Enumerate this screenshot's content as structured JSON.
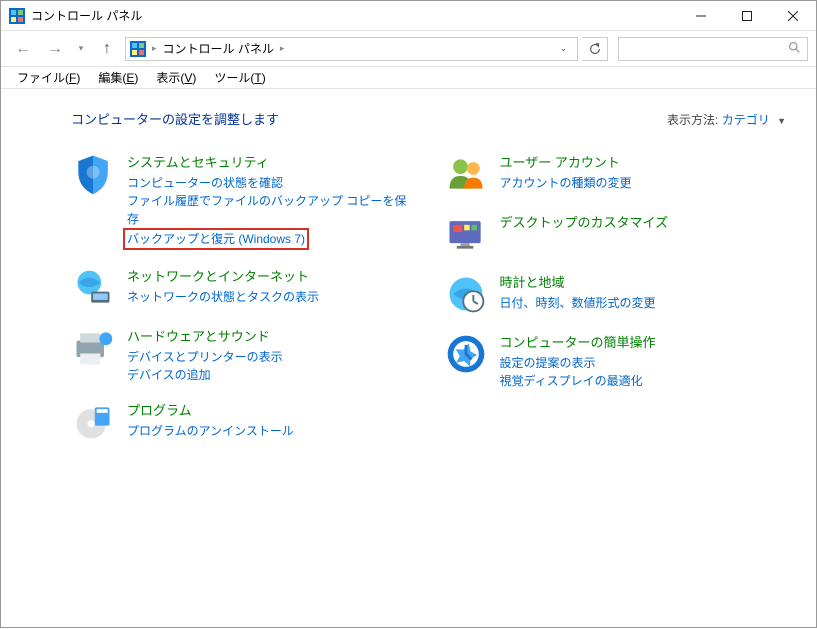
{
  "window": {
    "title": "コントロール パネル"
  },
  "breadcrumb": {
    "root": "コントロール パネル"
  },
  "search": {
    "placeholder": ""
  },
  "menu": {
    "file": "ファイル(F)",
    "edit": "編集(E)",
    "view": "表示(V)",
    "tools": "ツール(T)"
  },
  "heading": "コンピューターの設定を調整します",
  "viewby": {
    "label": "表示方法:",
    "value": "カテゴリ"
  },
  "left": [
    {
      "title": "システムとセキュリティ",
      "links": [
        "コンピューターの状態を確認",
        "ファイル履歴でファイルのバックアップ コピーを保存",
        "バックアップと復元 (Windows 7)"
      ],
      "highlight_index": 2
    },
    {
      "title": "ネットワークとインターネット",
      "links": [
        "ネットワークの状態とタスクの表示"
      ]
    },
    {
      "title": "ハードウェアとサウンド",
      "links": [
        "デバイスとプリンターの表示",
        "デバイスの追加"
      ]
    },
    {
      "title": "プログラム",
      "links": [
        "プログラムのアンインストール"
      ]
    }
  ],
  "right": [
    {
      "title": "ユーザー アカウント",
      "links": [
        "アカウントの種類の変更"
      ]
    },
    {
      "title": "デスクトップのカスタマイズ",
      "links": []
    },
    {
      "title": "時計と地域",
      "links": [
        "日付、時刻、数値形式の変更"
      ]
    },
    {
      "title": "コンピューターの簡単操作",
      "links": [
        "設定の提案の表示",
        "視覚ディスプレイの最適化"
      ]
    }
  ]
}
